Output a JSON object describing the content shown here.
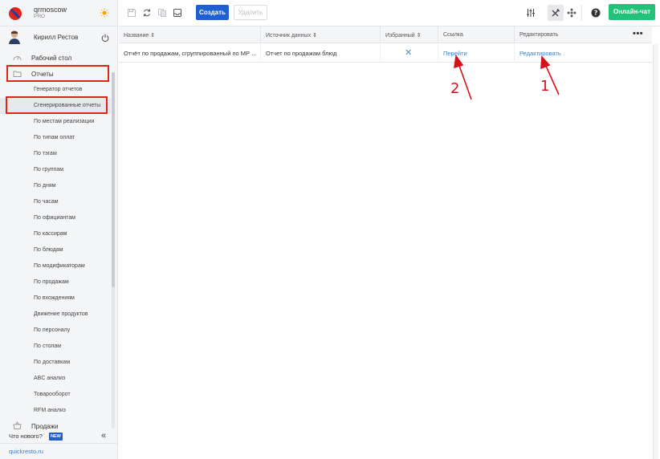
{
  "account": {
    "name": "qrmoscow",
    "plan": "PRO"
  },
  "user": {
    "name": "Кирилл Рестов"
  },
  "nav": {
    "dashboard": "Рабочий стол",
    "reports": "Отчеты",
    "sales": "Продажи",
    "report_items": [
      "Генератор отчетов",
      "Сгенерированные отчеты",
      "По местам реализации",
      "По типам оплат",
      "По тэгам",
      "По группам",
      "По дням",
      "По часам",
      "По официантам",
      "По кассирам",
      "По блюдам",
      "По модификаторам",
      "По продажам",
      "По вхождениям",
      "Движение продуктов",
      "По персоналу",
      "По столам",
      "По доставкам",
      "ABC анализ",
      "Товарооборот",
      "RFM анализ"
    ]
  },
  "footer": {
    "whats_new": "Что нового?",
    "new_badge": "NEW",
    "collapse": "«",
    "site": "quickresto.ru"
  },
  "toolbar": {
    "create": "Создать",
    "delete": "Удалить",
    "chat": "Онлайн-чат"
  },
  "table": {
    "headers": [
      "Название ⇕",
      "Источник данных ⇕",
      "Избранный ⇕",
      "Ссылка",
      "Редактировать"
    ],
    "more": "•••",
    "row": {
      "name": "Отчёт по продажам, сгруппированный по МР ...",
      "source": "Отчет по продажам блюд",
      "favorite": "✕",
      "link": "Перейти",
      "edit": "Редактировать"
    }
  },
  "annotations": {
    "one": "1",
    "two": "2"
  },
  "colors": {
    "accent": "#1e5fd1",
    "chat": "#23c27a",
    "highlight": "#e1251b",
    "link": "#3a7fc1"
  }
}
